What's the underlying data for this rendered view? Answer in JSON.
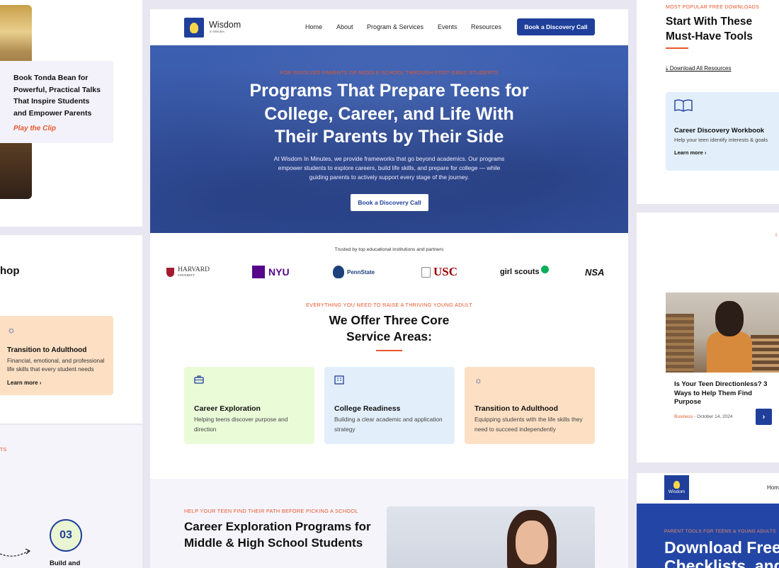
{
  "left": {
    "promo_text": "Book Tonda Bean for Powerful, Practical Talks That Inspire Students and Empower Parents",
    "play_clip": "Play the Clip",
    "clip_title": "hop",
    "card": {
      "title": "Transition to Adulthood",
      "body": "Financial, emotional, and professional life skills that every student needs",
      "link": "Learn more ›"
    },
    "eyebrow": "TS",
    "step_number": "03",
    "step_label": "Build and"
  },
  "center": {
    "nav": {
      "logo": "Wisdom",
      "logo_sub": "In Minutes",
      "links": [
        "Home",
        "About",
        "Program & Services",
        "Events",
        "Resources"
      ],
      "cta": "Book a Discovery Call"
    },
    "hero": {
      "eyebrow": "FOR INVOLVED PARENTS OF MIDDLE SCHOOL THROUGH POST-GRAD STUDENTS",
      "title": "Programs That Prepare Teens for College, Career, and Life With Their Parents by Their Side",
      "body": "At Wisdom In Minutes, we provide frameworks that go beyond academics. Our programs empower students to explore careers, build life skills, and prepare for college — while guiding parents to actively support every stage of the journey.",
      "cta": "Book a Discovery Call"
    },
    "trusted": "Trusted by top educational institutions and partners",
    "logos": {
      "harvard": "HARVARD",
      "harvard_sub": "UNIVERSITY",
      "nyu": "NYU",
      "pennstate": "PennState",
      "usc": "USC",
      "girlscouts": "girl scouts",
      "nsa": "NSA"
    },
    "core": {
      "eyebrow": "EVERYTHING YOU NEED TO RAISE A THRIVING YOUNG ADULT",
      "title": "We Offer Three Core Service Areas:",
      "services": [
        {
          "icon": "briefcase-icon",
          "title": "Career Exploration",
          "body": "Helping teens discover purpose and direction"
        },
        {
          "icon": "building-icon",
          "title": "College Readiness",
          "body": "Building a clear academic and application strategy"
        },
        {
          "icon": "lightbulb-icon",
          "title": "Transition to Adulthood",
          "body": "Equipping students with the life skills they need to succeed independently"
        }
      ]
    },
    "career": {
      "eyebrow": "HELP YOUR TEEN FIND THEIR PATH BEFORE PICKING A SCHOOL",
      "title": "Career Exploration Programs for Middle & High School Students"
    }
  },
  "right": {
    "top": {
      "eyebrow": "MOST POPULAR FREE DOWNLOADS",
      "title": "Start With These Must-Have Tools",
      "download_all": "Download All Resources",
      "card": {
        "title": "Career Discovery Workbook",
        "body": "Help your teen identify interests & goals",
        "link": "Learn more ›"
      }
    },
    "mid": {
      "post_title": "Is Your Teen Directionless? 3 Ways to Help Them Find Purpose",
      "category": "Business",
      "date": "October 14, 2024",
      "edge_text": "I"
    },
    "bottom": {
      "logo": "Wisdom",
      "nav_home": "Hom",
      "eyebrow": "PARENT TOOLS FOR TEENS & YOUNG ADULTS",
      "title": "Download Free Checklists, and"
    }
  },
  "colors": {
    "brand_blue": "#1f3f9a",
    "accent_orange": "#e8562a",
    "green_card": "#eafbd8",
    "blue_card": "#e2effb",
    "orange_card": "#fde0c4"
  }
}
